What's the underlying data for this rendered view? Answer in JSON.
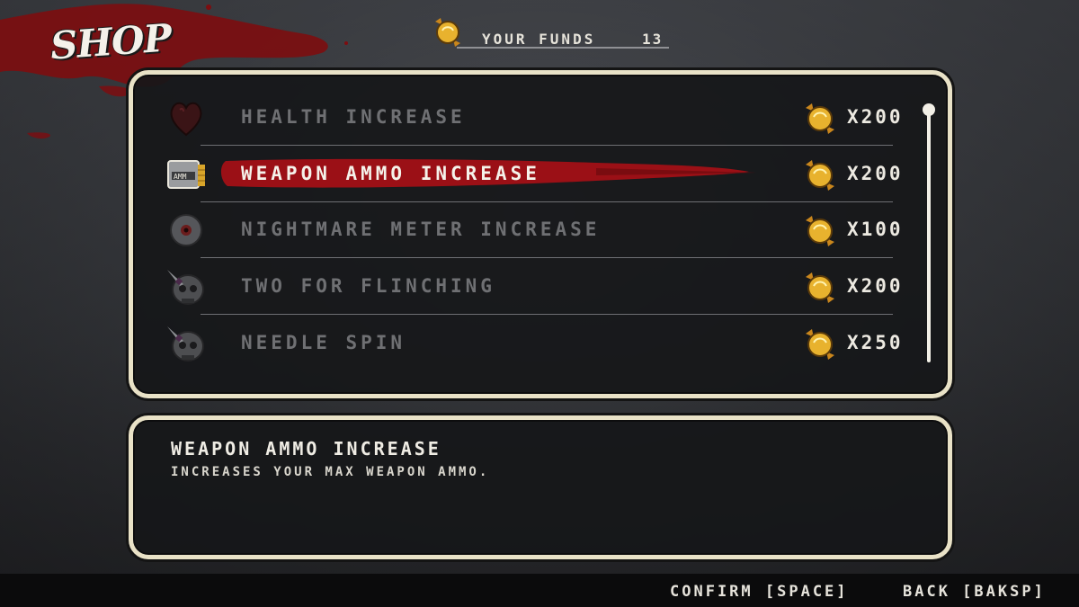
{
  "header": {
    "title": "SHOP",
    "funds_label": "YOUR FUNDS",
    "funds_value": "13"
  },
  "items": [
    {
      "name": "HEALTH INCREASE",
      "price": "X200",
      "icon": "heart-icon",
      "selected": false
    },
    {
      "name": "WEAPON AMMO INCREASE",
      "price": "X200",
      "icon": "ammo-box-icon",
      "selected": true
    },
    {
      "name": "NIGHTMARE METER INCREASE",
      "price": "X100",
      "icon": "eyeball-icon",
      "selected": false
    },
    {
      "name": "TWO FOR FLINCHING",
      "price": "X200",
      "icon": "skull-knife-icon",
      "selected": false
    },
    {
      "name": "NEEDLE SPIN",
      "price": "X250",
      "icon": "skull-knife-icon",
      "selected": false
    }
  ],
  "description": {
    "title": "WEAPON AMMO INCREASE",
    "text": "INCREASES YOUR MAX WEAPON AMMO."
  },
  "footer": {
    "confirm": "CONFIRM [SPACE]",
    "back": "BACK [BAKSP]"
  },
  "colors": {
    "panel_border": "#e9e2c7",
    "highlight": "#9b1016",
    "coin": "#e0a82a",
    "unselected_text": "#6f7073"
  }
}
